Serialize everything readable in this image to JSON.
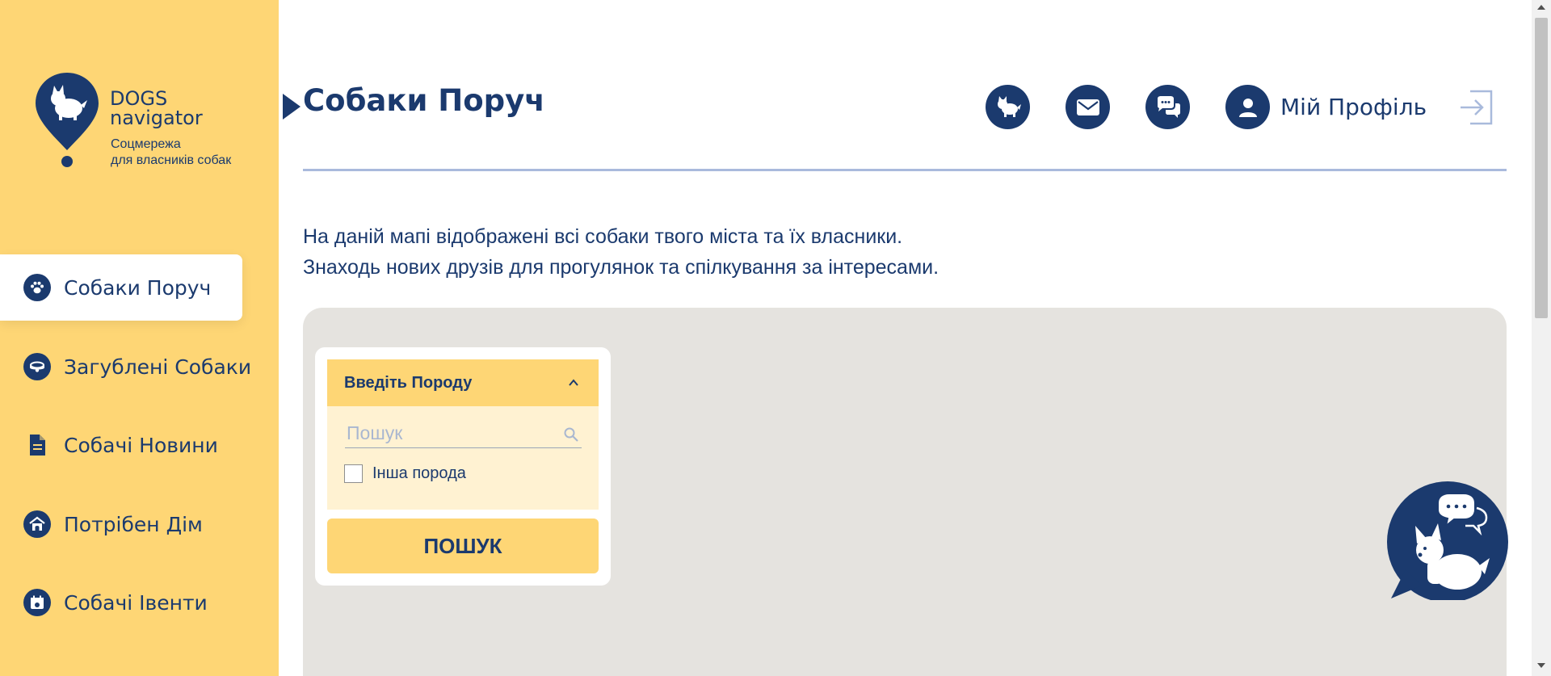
{
  "brand": {
    "line1": "DOGS",
    "line2": "navigator",
    "tagline1": "Соцмережа",
    "tagline2": "для власників собак"
  },
  "sidebar": {
    "items": [
      {
        "label": "Собаки Поруч",
        "icon": "paw-icon",
        "active": true
      },
      {
        "label": "Загублені Собаки",
        "icon": "collar-icon",
        "active": false
      },
      {
        "label": "Собачі Новини",
        "icon": "document-icon",
        "active": false
      },
      {
        "label": "Потрібен Дім",
        "icon": "doghouse-icon",
        "active": false
      },
      {
        "label": "Собачі Івенти",
        "icon": "calendar-icon",
        "active": false
      }
    ]
  },
  "header": {
    "title": "Собаки Поруч",
    "icons": [
      "dog-icon",
      "mail-icon",
      "chat-icon",
      "user-icon"
    ],
    "profile_label": "Мій Профіль",
    "logout_icon": "logout-icon"
  },
  "intro": {
    "line1": "На даній мапі відображені всі собаки твого міста та їх власники.",
    "line2": "Знаходь нових друзів для прогулянок та спілкування за інтересами."
  },
  "filter": {
    "header_label": "Введіть Породу",
    "search_placeholder": "Пошук",
    "search_value": "",
    "checkbox_label": "Інша порода",
    "checkbox_checked": false,
    "button_label": "ПОШУК"
  },
  "colors": {
    "sidebar_bg": "#FED675",
    "navy": "#1B3A6E",
    "map_bg": "#E5E3DF",
    "filter_body_bg": "#FFF2D2",
    "divider": "#A9BADC"
  }
}
